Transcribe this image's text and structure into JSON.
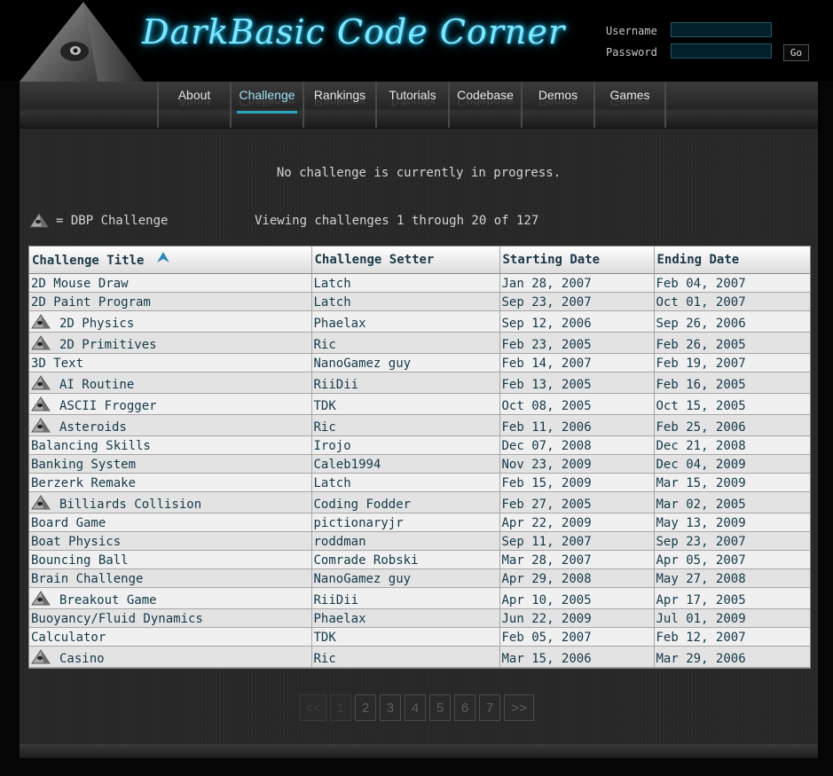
{
  "header": {
    "site_title": "DarkBasic Code Corner",
    "username_label": "Username",
    "password_label": "Password",
    "go_label": "Go"
  },
  "nav": {
    "items": [
      {
        "label": "About"
      },
      {
        "label": "Challenge"
      },
      {
        "label": "Rankings"
      },
      {
        "label": "Tutorials"
      },
      {
        "label": "Codebase"
      },
      {
        "label": "Demos"
      },
      {
        "label": "Games"
      }
    ],
    "active_index": 1
  },
  "status_message": "No challenge is currently in progress.",
  "legend_text": "= DBP Challenge",
  "viewing_text": "Viewing challenges 1 through 20 of 127",
  "table": {
    "headers": [
      "Challenge Title",
      "Challenge Setter",
      "Starting Date",
      "Ending Date"
    ],
    "sorted_column": 0,
    "sort_direction": "ascending",
    "rows": [
      {
        "title": "2D Mouse Draw",
        "setter": "Latch",
        "start": "Jan 28, 2007",
        "end": "Feb 04, 2007",
        "dbp": false
      },
      {
        "title": "2D Paint Program",
        "setter": "Latch",
        "start": "Sep 23, 2007",
        "end": "Oct 01, 2007",
        "dbp": false
      },
      {
        "title": "2D Physics",
        "setter": "Phaelax",
        "start": "Sep 12, 2006",
        "end": "Sep 26, 2006",
        "dbp": true
      },
      {
        "title": "2D Primitives",
        "setter": "Ric",
        "start": "Feb 23, 2005",
        "end": "Feb 26, 2005",
        "dbp": true
      },
      {
        "title": "3D Text",
        "setter": "NanoGamez guy",
        "start": "Feb 14, 2007",
        "end": "Feb 19, 2007",
        "dbp": false
      },
      {
        "title": "AI Routine",
        "setter": "RiiDii",
        "start": "Feb 13, 2005",
        "end": "Feb 16, 2005",
        "dbp": true
      },
      {
        "title": "ASCII Frogger",
        "setter": "TDK",
        "start": "Oct 08, 2005",
        "end": "Oct 15, 2005",
        "dbp": true
      },
      {
        "title": "Asteroids",
        "setter": "Ric",
        "start": "Feb 11, 2006",
        "end": "Feb 25, 2006",
        "dbp": true
      },
      {
        "title": "Balancing Skills",
        "setter": "Irojo",
        "start": "Dec 07, 2008",
        "end": "Dec 21, 2008",
        "dbp": false
      },
      {
        "title": "Banking System",
        "setter": "Caleb1994",
        "start": "Nov 23, 2009",
        "end": "Dec 04, 2009",
        "dbp": false
      },
      {
        "title": "Berzerk Remake",
        "setter": "Latch",
        "start": "Feb 15, 2009",
        "end": "Mar 15, 2009",
        "dbp": false
      },
      {
        "title": "Billiards Collision",
        "setter": "Coding Fodder",
        "start": "Feb 27, 2005",
        "end": "Mar 02, 2005",
        "dbp": true
      },
      {
        "title": "Board Game",
        "setter": "pictionaryjr",
        "start": "Apr 22, 2009",
        "end": "May 13, 2009",
        "dbp": false
      },
      {
        "title": "Boat Physics",
        "setter": "roddman",
        "start": "Sep 11, 2007",
        "end": "Sep 23, 2007",
        "dbp": false
      },
      {
        "title": "Bouncing Ball",
        "setter": "Comrade Robski",
        "start": "Mar 28, 2007",
        "end": "Apr 05, 2007",
        "dbp": false
      },
      {
        "title": "Brain Challenge",
        "setter": "NanoGamez guy",
        "start": "Apr 29, 2008",
        "end": "May 27, 2008",
        "dbp": false
      },
      {
        "title": "Breakout Game",
        "setter": "RiiDii",
        "start": "Apr 10, 2005",
        "end": "Apr 17, 2005",
        "dbp": true
      },
      {
        "title": "Buoyancy/Fluid Dynamics",
        "setter": "Phaelax",
        "start": "Jun 22, 2009",
        "end": "Jul 01, 2009",
        "dbp": false
      },
      {
        "title": "Calculator",
        "setter": "TDK",
        "start": "Feb 05, 2007",
        "end": "Feb 12, 2007",
        "dbp": false
      },
      {
        "title": "Casino",
        "setter": "Ric",
        "start": "Mar 15, 2006",
        "end": "Mar 29, 2006",
        "dbp": true
      }
    ]
  },
  "pagination": {
    "buttons": [
      {
        "label": "<<",
        "disabled": true
      },
      {
        "label": "1",
        "disabled": true
      },
      {
        "label": "2",
        "disabled": false
      },
      {
        "label": "3",
        "disabled": false
      },
      {
        "label": "4",
        "disabled": false
      },
      {
        "label": "5",
        "disabled": false
      },
      {
        "label": "6",
        "disabled": false
      },
      {
        "label": "7",
        "disabled": false
      },
      {
        "label": ">>",
        "disabled": false
      }
    ]
  },
  "icons": {
    "legend": "dbp-pyramid-icon",
    "row_marker": "dbp-pyramid-icon",
    "sort": "sort-ascending-arrow-icon"
  },
  "colors": {
    "accent": "#2aa5c2",
    "title_glow": "#7fe6ff",
    "table_text": "#14394a"
  }
}
